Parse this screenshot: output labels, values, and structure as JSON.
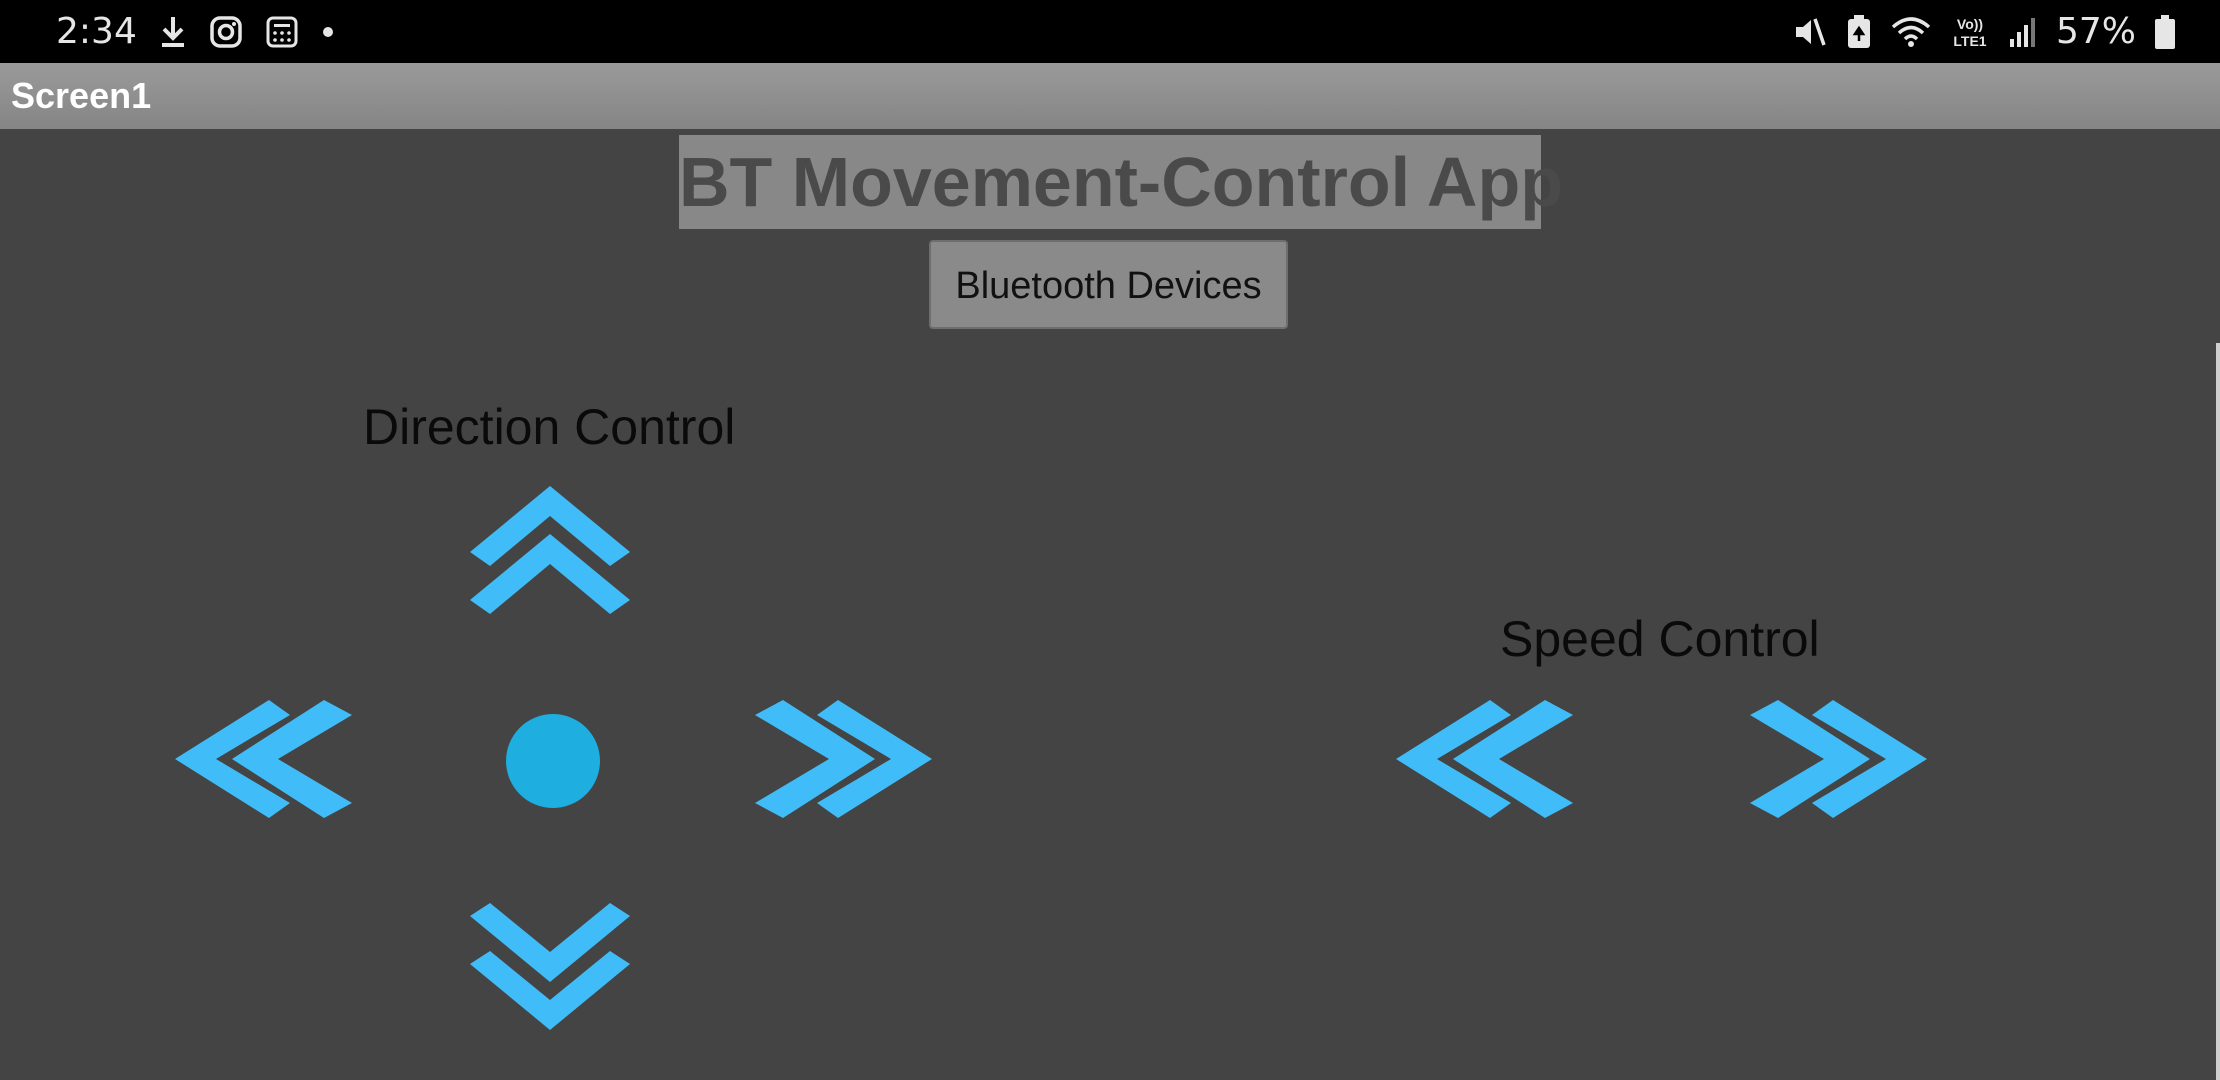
{
  "status_bar": {
    "time": "2:34",
    "battery_percent": "57%",
    "network_label": "VoLTE1",
    "left_icons": [
      "download-icon",
      "instagram-icon",
      "calculator-icon",
      "dot-icon"
    ],
    "right_icons": [
      "mute-icon",
      "battery-saver-icon",
      "wifi-icon",
      "signal-icon",
      "battery-icon"
    ]
  },
  "app_bar": {
    "title": "Screen1"
  },
  "main": {
    "heading": "BT Movement-Control App",
    "bluetooth_button_label": "Bluetooth Devices",
    "direction_label": "Direction Control",
    "speed_label": "Speed Control"
  },
  "controls": {
    "direction": [
      "forward-arrow-icon",
      "left-arrow-icon",
      "stop-icon",
      "right-arrow-icon",
      "backward-arrow-icon"
    ],
    "speed": [
      "speed-down-arrow-icon",
      "speed-up-arrow-icon"
    ]
  },
  "colors": {
    "background": "#444444",
    "accent_arrow": "#40bdf8",
    "stop_circle": "#1eaee0",
    "title_bar": "#8e8e8e"
  }
}
